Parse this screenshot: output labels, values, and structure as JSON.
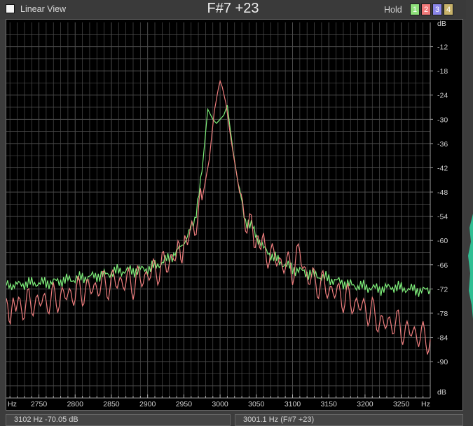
{
  "toolbar": {
    "linear_view_label": "Linear View",
    "linear_view_checked": false,
    "note": "F#7 +23",
    "hold_label": "Hold",
    "hold_buttons": [
      {
        "label": "1",
        "color": "#8ee07a",
        "text_color": "#ffffff"
      },
      {
        "label": "2",
        "color": "#f07a7a",
        "text_color": "#ffffff"
      },
      {
        "label": "3",
        "color": "#8a86e8",
        "text_color": "#ffffff"
      },
      {
        "label": "4",
        "color": "#c8b36a",
        "text_color": "#ffffff"
      }
    ]
  },
  "status": {
    "cursor_readout": "3102 Hz  -70.05 dB",
    "peak_readout": "3001.1 Hz (F#7 +23)"
  },
  "colors": {
    "series_green": "#7ef07a",
    "series_red": "#f07e7e",
    "grid": "#4d4d4d",
    "axis_text": "#d2d2d2"
  },
  "chart_data": {
    "type": "line",
    "x_unit_label": "Hz",
    "y_unit_label": "dB",
    "x_ticks": [
      2750,
      2800,
      2850,
      2900,
      2950,
      3000,
      3050,
      3100,
      3150,
      3200,
      3250
    ],
    "xlim": [
      2705,
      3290
    ],
    "y_ticks": [
      -12,
      -18,
      -24,
      -30,
      -36,
      -42,
      -48,
      -54,
      -60,
      -66,
      -72,
      -78,
      -84,
      -90
    ],
    "ylim": [
      -99,
      -6
    ],
    "grid": true,
    "series": [
      {
        "color": "#7ef07a",
        "x": [
          2705,
          2720,
          2740,
          2760,
          2780,
          2800,
          2820,
          2840,
          2860,
          2880,
          2900,
          2920,
          2940,
          2955,
          2965,
          2975,
          2983,
          2990,
          2995,
          3000,
          3005,
          3010,
          3013,
          3018,
          3025,
          3035,
          3045,
          3060,
          3080,
          3100,
          3120,
          3140,
          3160,
          3180,
          3200,
          3220,
          3240,
          3260,
          3280,
          3290
        ],
        "y": [
          -71,
          -71,
          -70.5,
          -70.5,
          -70,
          -69.5,
          -69,
          -68.5,
          -67.5,
          -67.5,
          -67,
          -65.5,
          -63,
          -59,
          -55,
          -43,
          -27.5,
          -30,
          -31,
          -30,
          -29,
          -26.5,
          -31,
          -38,
          -46,
          -55,
          -57,
          -62,
          -65,
          -67,
          -68,
          -69,
          -70,
          -71,
          -71.5,
          -72,
          -71.5,
          -72,
          -72.5,
          -72
        ]
      },
      {
        "color": "#f07e7e",
        "x": [
          2705,
          2720,
          2740,
          2760,
          2780,
          2800,
          2820,
          2840,
          2860,
          2880,
          2900,
          2920,
          2940,
          2955,
          2965,
          2975,
          2985,
          2992,
          2998,
          3000,
          3003,
          3008,
          3015,
          3025,
          3035,
          3045,
          3060,
          3080,
          3100,
          3110,
          3120,
          3140,
          3160,
          3180,
          3200,
          3210,
          3220,
          3230,
          3240,
          3250,
          3260,
          3270,
          3280,
          3290
        ],
        "y": [
          -77,
          -76.5,
          -75.5,
          -75,
          -74,
          -73,
          -72,
          -71,
          -70,
          -70.5,
          -68.5,
          -66.5,
          -63.5,
          -60,
          -56,
          -50,
          -40,
          -28,
          -22,
          -20.5,
          -22,
          -26,
          -35,
          -46,
          -55,
          -58,
          -62,
          -65,
          -67,
          -63,
          -69,
          -71,
          -73,
          -75,
          -77,
          -78,
          -80,
          -81,
          -80,
          -82,
          -82.5,
          -83,
          -84,
          -84.5
        ]
      }
    ]
  }
}
